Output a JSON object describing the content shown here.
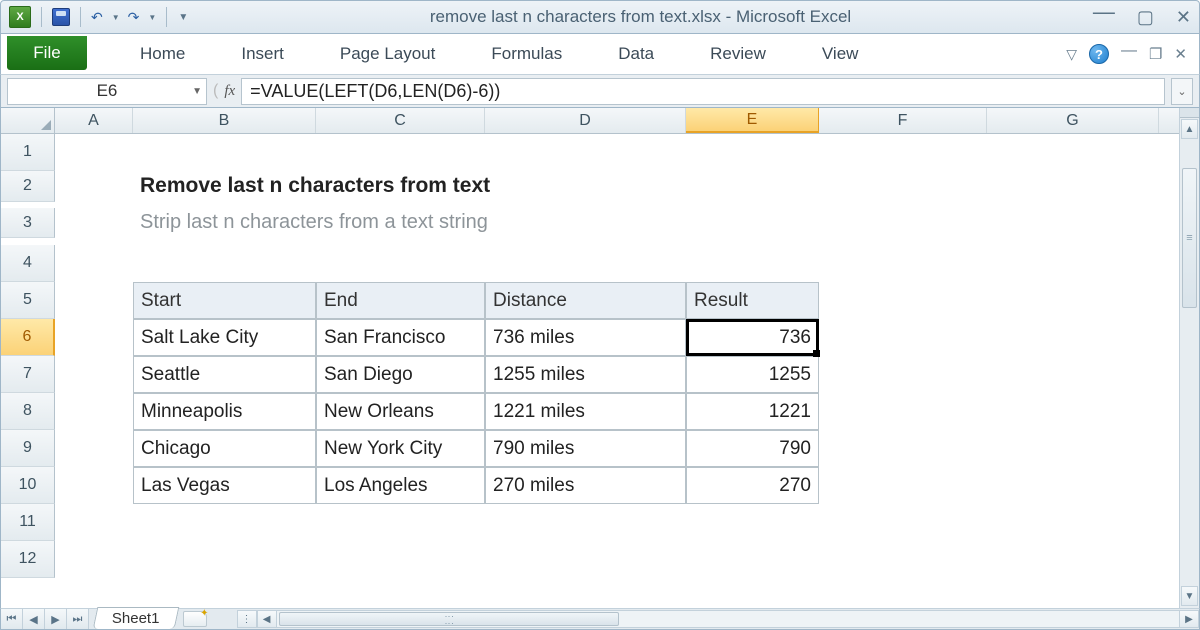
{
  "window": {
    "title": "remove last n characters from text.xlsx  -  Microsoft Excel"
  },
  "qat": {
    "logo": "X",
    "undo": "↶",
    "redo": "↷"
  },
  "ribbon": {
    "file": "File",
    "tabs": [
      "Home",
      "Insert",
      "Page Layout",
      "Formulas",
      "Data",
      "Review",
      "View"
    ],
    "help": "?"
  },
  "formula_bar": {
    "name_box": "E6",
    "fx": "fx",
    "formula": "=VALUE(LEFT(D6,LEN(D6)-6))"
  },
  "columns": [
    "A",
    "B",
    "C",
    "D",
    "E",
    "F",
    "G"
  ],
  "row_numbers": [
    "1",
    "2",
    "3",
    "4",
    "5",
    "6",
    "7",
    "8",
    "9",
    "10",
    "11",
    "12"
  ],
  "selected": {
    "col": "E",
    "row": "6"
  },
  "content": {
    "title": "Remove last n characters from text",
    "subtitle": "Strip last n characters from a text string",
    "headers": {
      "start": "Start",
      "end": "End",
      "distance": "Distance",
      "result": "Result"
    },
    "rows": [
      {
        "start": "Salt Lake City",
        "end": "San Francisco",
        "distance": "736 miles",
        "result": "736"
      },
      {
        "start": "Seattle",
        "end": "San Diego",
        "distance": "1255 miles",
        "result": "1255"
      },
      {
        "start": "Minneapolis",
        "end": "New Orleans",
        "distance": "1221 miles",
        "result": "1221"
      },
      {
        "start": "Chicago",
        "end": "New York City",
        "distance": "790 miles",
        "result": "790"
      },
      {
        "start": "Las Vegas",
        "end": "Los Angeles",
        "distance": "270 miles",
        "result": "270"
      }
    ]
  },
  "sheet": {
    "name": "Sheet1"
  }
}
